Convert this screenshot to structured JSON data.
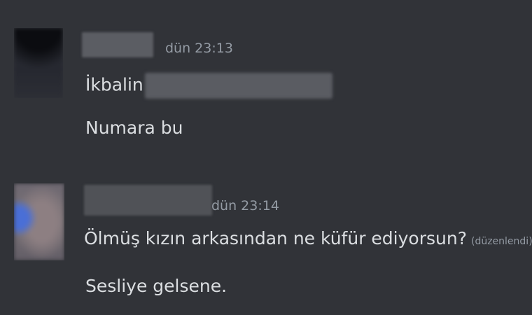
{
  "messages": [
    {
      "timestamp": "dün 23:13",
      "lines": [
        "İkbalin",
        "Numara bu"
      ]
    },
    {
      "timestamp": "dün 23:14",
      "lines": [
        "Ölmüş kızın arkasından ne küfür ediyorsun?",
        "Sesliye gelsene."
      ],
      "edited_label": "(düzenlendi)"
    }
  ],
  "colors": {
    "background": "#313338",
    "text": "#dbdee1",
    "muted": "#949ba4"
  }
}
